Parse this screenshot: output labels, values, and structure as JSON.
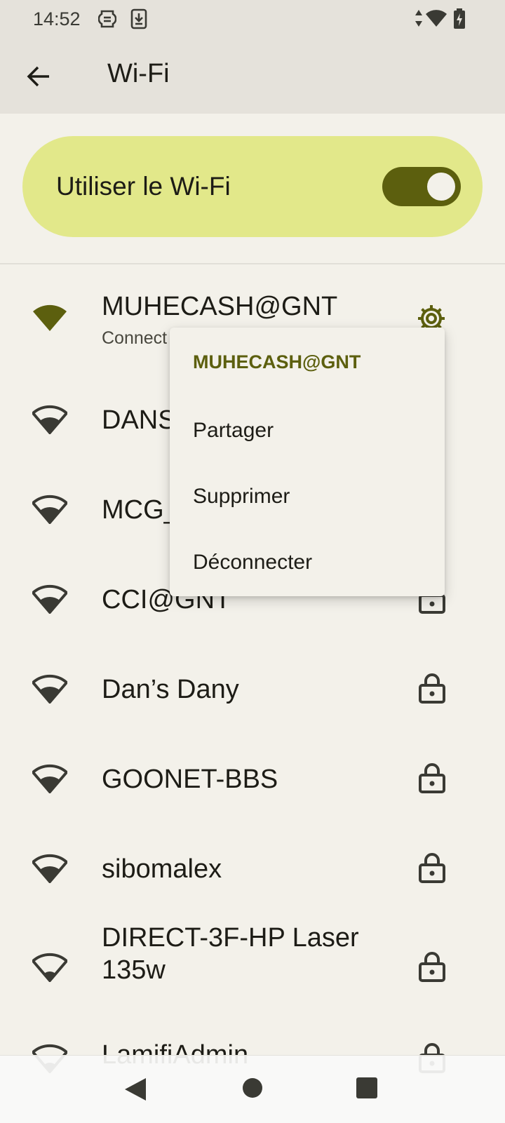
{
  "status_bar": {
    "time": "14:52"
  },
  "app_bar": {
    "title": "Wi-Fi"
  },
  "wifi_toggle": {
    "label": "Utiliser le Wi-Fi",
    "state": "on"
  },
  "networks": [
    {
      "name": "MUHECASH@GNT",
      "subtitle": "Connect",
      "connected": true
    },
    {
      "name": "DANS",
      "secured": true
    },
    {
      "name": "MCG_",
      "secured": true
    },
    {
      "name": "CCI@GNT",
      "secured": true
    },
    {
      "name": "Dan’s Dany",
      "secured": true
    },
    {
      "name": "GOONET-BBS",
      "secured": true
    },
    {
      "name": "sibomalex",
      "secured": true
    },
    {
      "name_line1": "DIRECT-3F-HP Laser",
      "name_line2": "135w",
      "secured": true
    },
    {
      "name": "LamifiAdmin",
      "secured": true
    }
  ],
  "context_menu": {
    "title": "MUHECASH@GNT",
    "items": [
      "Partager",
      "Supprimer",
      "Déconnecter"
    ]
  },
  "colors": {
    "accent": "#5c5f0e",
    "toggle_card": "#e2e88a",
    "background": "#f3f1ea",
    "header": "#e5e2db"
  }
}
